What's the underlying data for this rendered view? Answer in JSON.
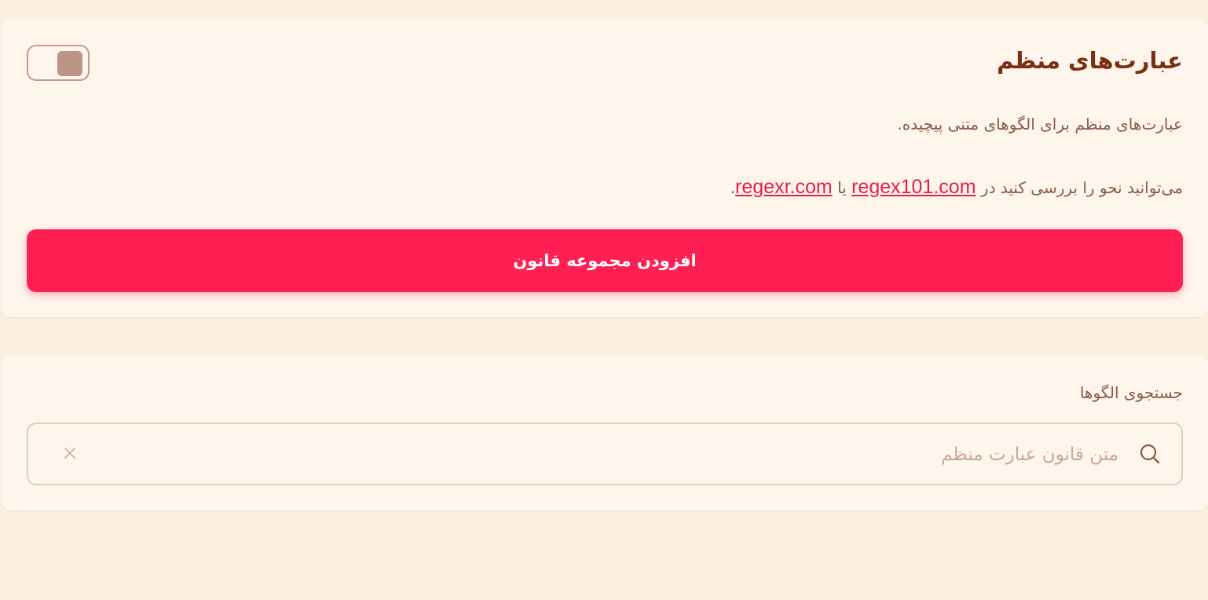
{
  "rules_card": {
    "title": "عبارت‌های منظم",
    "description": "عبارت‌های منظم برای الگوهای متنی پیچیده.",
    "syntax_text_before": "می‌توانید نحو را بررسی کنید در",
    "link_1": "regex101.com",
    "syntax_text_between": "یا",
    "link_2": "regexr.com",
    "syntax_text_after": ".",
    "add_button_label": "افزودن مجموعه قانون",
    "toggle_state": "off"
  },
  "search_card": {
    "label": "جستجوی الگوها",
    "placeholder": "متن قانون عبارت منظم",
    "value": ""
  },
  "colors": {
    "background": "#fdefdf",
    "card": "#fef5ec",
    "title": "#7a2e12",
    "accent": "#ff1f53",
    "link": "#e4204a",
    "muted": "#c9a896"
  },
  "icons": {
    "search": "search-icon",
    "clear": "close-icon"
  }
}
